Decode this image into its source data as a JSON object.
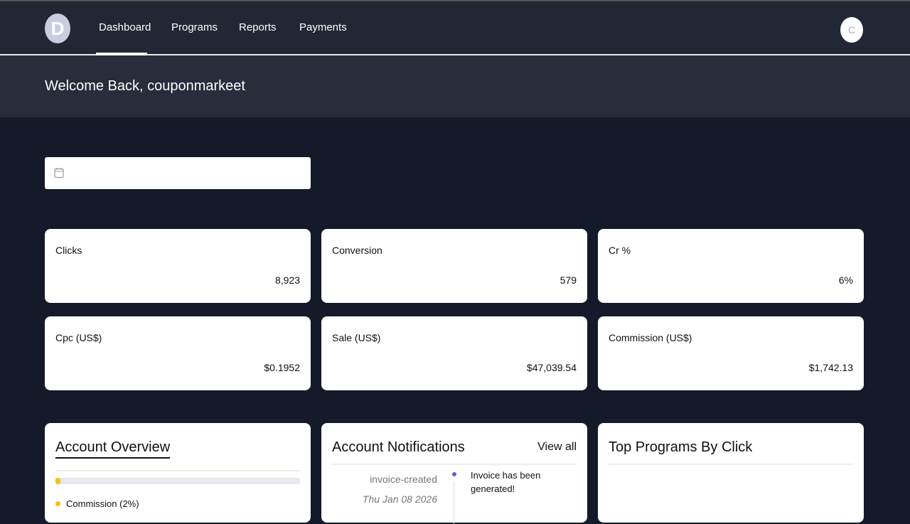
{
  "nav": {
    "logo": "D",
    "items": [
      "Dashboard",
      "Programs",
      "Reports",
      "Payments"
    ],
    "avatar": "C"
  },
  "welcome": "Welcome Back, couponmarkeet",
  "stats": [
    {
      "label": "Clicks",
      "value": "8,923"
    },
    {
      "label": "Conversion",
      "value": "579"
    },
    {
      "label": "Cr %",
      "value": "6%"
    },
    {
      "label": "Cpc (US$)",
      "value": "$0.1952"
    },
    {
      "label": "Sale (US$)",
      "value": "$47,039.54"
    },
    {
      "label": "Commission (US$)",
      "value": "$1,742.13"
    }
  ],
  "overview": {
    "title": "Account Overview",
    "legend": "Commission (2%)",
    "progress_percent": 2,
    "color": "#f0c419"
  },
  "notifications": {
    "title": "Account Notifications",
    "view_all": "View all",
    "items": [
      {
        "type": "invoice-created",
        "date": "Thu Jan 08 2026",
        "message": "Invoice has been generated!"
      }
    ]
  },
  "top_programs": {
    "title": "Top Programs By Click"
  }
}
